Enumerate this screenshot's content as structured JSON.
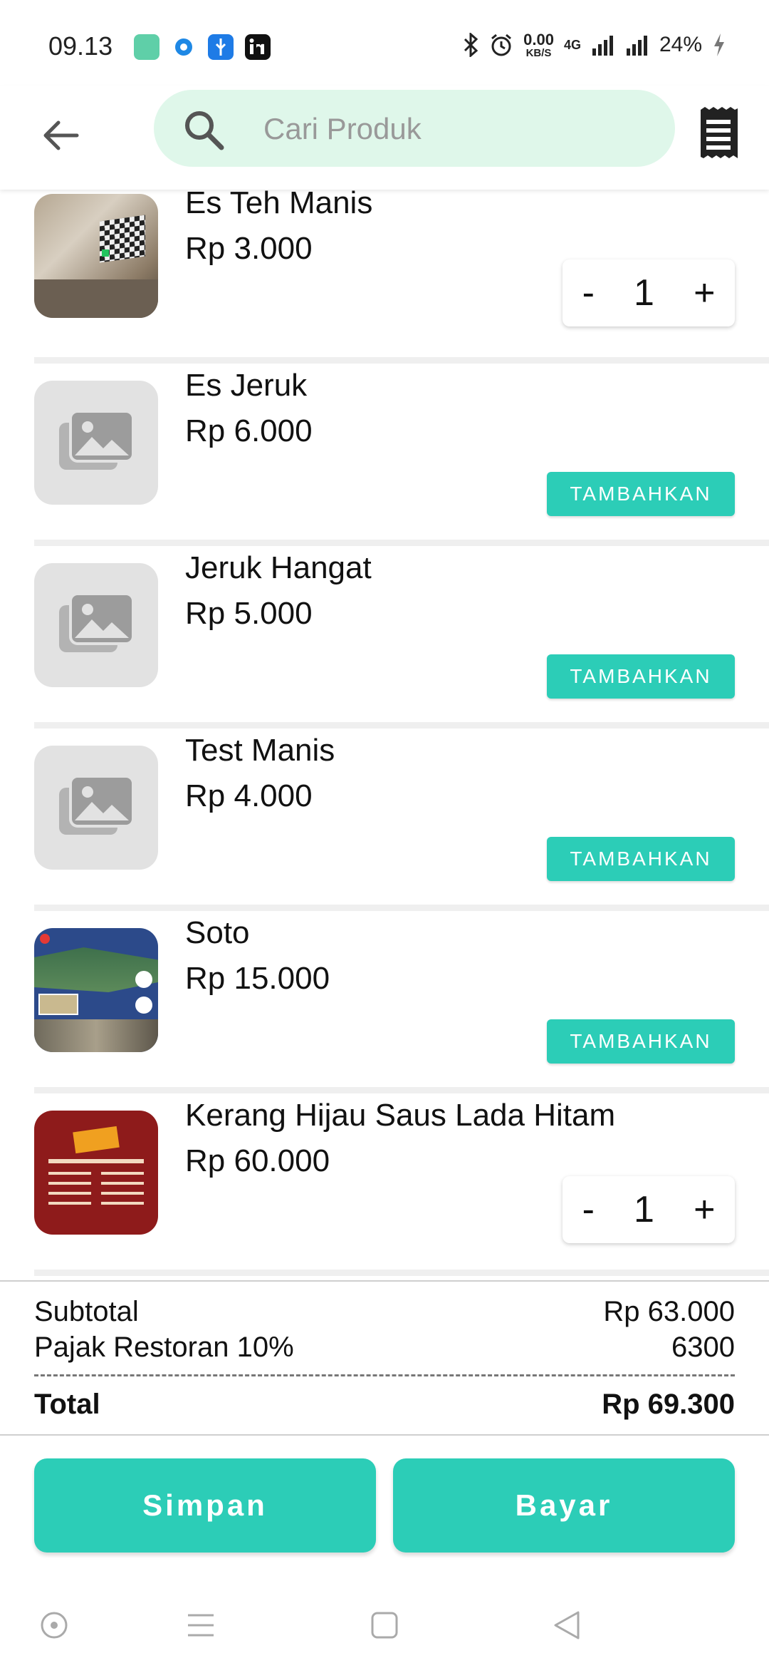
{
  "status_bar": {
    "time": "09.13",
    "net_speed_value": "0.00",
    "net_speed_unit": "KB/S",
    "network": "4G",
    "battery": "24%"
  },
  "search": {
    "placeholder": "Cari Produk",
    "value": ""
  },
  "products": [
    {
      "name": "Es Teh Manis",
      "price": "Rp 3.000",
      "qty": "1",
      "in_cart": true
    },
    {
      "name": "Es Jeruk",
      "price": "Rp 6.000",
      "add_label": "TAMBAHKAN",
      "in_cart": false
    },
    {
      "name": "Jeruk Hangat",
      "price": "Rp 5.000",
      "add_label": "TAMBAHKAN",
      "in_cart": false
    },
    {
      "name": "Test Manis",
      "price": "Rp 4.000",
      "add_label": "TAMBAHKAN",
      "in_cart": false
    },
    {
      "name": "Soto",
      "price": "Rp 15.000",
      "add_label": "TAMBAHKAN",
      "in_cart": false
    },
    {
      "name": "Kerang Hijau Saus Lada Hitam",
      "price": "Rp 60.000",
      "qty": "1",
      "in_cart": true
    }
  ],
  "qty_controls": {
    "minus": "-",
    "plus": "+"
  },
  "summary": {
    "subtotal_label": "Subtotal",
    "subtotal_value": "Rp 63.000",
    "tax_label": "Pajak Restoran 10%",
    "tax_value": "6300",
    "total_label": "Total",
    "total_value": "Rp 69.300"
  },
  "actions": {
    "save_label": "Simpan",
    "pay_label": "Bayar"
  },
  "colors": {
    "accent": "#2ccdb7",
    "search_bg": "#dff7ea",
    "placeholder_bg": "#e2e2e2"
  }
}
